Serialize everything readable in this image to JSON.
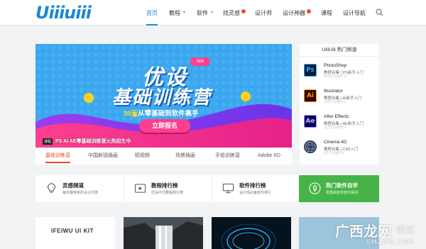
{
  "logo": "Uiiiuiii",
  "nav": {
    "items": [
      {
        "label": "首页",
        "active": true
      },
      {
        "label": "教程",
        "dropdown": true
      },
      {
        "label": "软件",
        "dropdown": true
      },
      {
        "label": "找灵感",
        "badge": true
      },
      {
        "label": "设计师"
      },
      {
        "label": "设计神器",
        "dropdown": true,
        "badge": true
      },
      {
        "label": "课程"
      },
      {
        "label": "设计导航"
      }
    ]
  },
  "banner": {
    "hot_tag": "hot",
    "title_line1": "优设",
    "title_line2": "基础训练营",
    "subtitle_days": "30天",
    "subtitle_rest": "从零基础到软件高手",
    "cta": "立即报名",
    "caption_tag": "课程",
    "caption": "PS AI AE零基础训练营火热招生中"
  },
  "tabs": [
    "基础训练营",
    "中国新锐插画",
    "短视频",
    "场景插画",
    "手绘训练营",
    "Adobe XD"
  ],
  "hot": {
    "title": "UiiiUiii 热门频道",
    "items": [
      {
        "abbr": "Ps",
        "name": "PhotoShop",
        "sub": "教程合集 | PS新手入门",
        "sub2": "30万人已经学习",
        "color": "#31a8ff",
        "bg": "#001e36"
      },
      {
        "abbr": "Ai",
        "name": "Illustrator",
        "sub": "教程合集 | AI新手入门",
        "sub2": "13万人已经学习",
        "color": "#ff9a00",
        "bg": "#330000"
      },
      {
        "abbr": "Ae",
        "name": "After Effects",
        "sub": "教程合集 | AE新手入门",
        "sub2": "11万人已经学习",
        "color": "#d8a6ff",
        "bg": "#00005b"
      },
      {
        "abbr": "C4D",
        "name": "Cinema 4D",
        "sub": "教程合集 | C4D入门",
        "sub2": "8万人已经学习",
        "color": "#ffffff",
        "bg": "#1f2a3c"
      }
    ]
  },
  "features": [
    {
      "title": "灵感频道",
      "sub": "每天都有新的设计灵感",
      "icon": "lightbulb-icon"
    },
    {
      "title": "教程排行榜",
      "sub": "优设中文教程排行榜",
      "icon": "video-icon"
    },
    {
      "title": "软件排行榜",
      "sub": "设计师必备软件排行",
      "icon": "monitor-icon"
    },
    {
      "title": "热门软件自学",
      "sub": "零基础自学软件系列",
      "icon": "leaf-icon"
    }
  ],
  "thumbs": [
    {
      "label": "IFEIWU UI KIT"
    }
  ],
  "watermark": {
    "line1": "广西龙网",
    "line2": "SMZDM.COM",
    "extra": "得买"
  },
  "colors": {
    "accent": "#1e88d3",
    "green": "#47b449",
    "hot": "#e44d26"
  }
}
